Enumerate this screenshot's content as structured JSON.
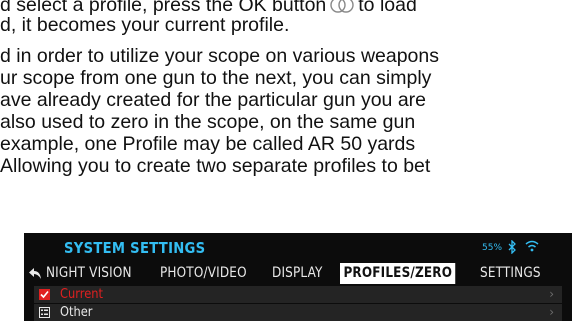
{
  "manual": {
    "line1_before_icon": "d select a profile, press the OK button",
    "line1_after_icon": "to load",
    "line2": "d, it becomes your current profile.",
    "line3": "d in order to utilize your scope on various weapons",
    "line4": "ur scope from one gun to the next, you can simply",
    "line5": "ave already created for the particular gun you are",
    "line6": "also used to zero in the scope, on the same gun",
    "line7": "example, one Profile may be called AR 50 yards",
    "line8": "Allowing you to create two separate profiles to bet"
  },
  "device": {
    "title": "SYSTEM SETTINGS",
    "battery": "55%",
    "icons": {
      "bluetooth": "bluetooth-icon",
      "wifi": "wifi-icon",
      "back": "back-arrow-icon"
    },
    "accent_color": "#33bdf2",
    "tabs": [
      {
        "label": "NIGHT VISION"
      },
      {
        "label": "PHOTO/VIDEO"
      },
      {
        "label": "DISPLAY"
      },
      {
        "label": "PROFILES/ZERO",
        "active": true
      },
      {
        "label": "SETTINGS"
      }
    ],
    "rows": [
      {
        "label": "Current",
        "icon": "checkbox-checked-icon",
        "color": "#e02020",
        "chevron": "›"
      },
      {
        "label": "Other",
        "icon": "list-icon",
        "color": "#e9e9e9",
        "chevron": "›"
      }
    ]
  }
}
